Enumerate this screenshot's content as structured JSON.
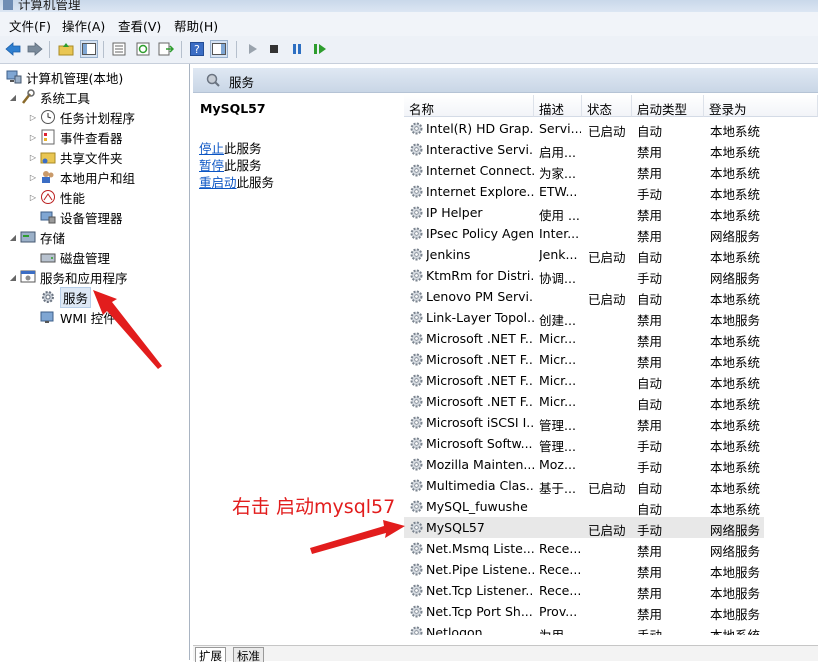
{
  "window": {
    "title": "计算机管理"
  },
  "menu": [
    {
      "label": "文件(F)"
    },
    {
      "label": "操作(A)"
    },
    {
      "label": "查看(V)"
    },
    {
      "label": "帮助(H)"
    }
  ],
  "tree": {
    "root": "计算机管理(本地)",
    "items": [
      {
        "label": "系统工具",
        "level": 1,
        "expanded": true,
        "icon": "tools-icon"
      },
      {
        "label": "任务计划程序",
        "level": 2,
        "expanded": false,
        "icon": "clock-icon"
      },
      {
        "label": "事件查看器",
        "level": 2,
        "expanded": false,
        "icon": "event-viewer-icon"
      },
      {
        "label": "共享文件夹",
        "level": 2,
        "expanded": false,
        "icon": "shared-folder-icon"
      },
      {
        "label": "本地用户和组",
        "level": 2,
        "expanded": false,
        "icon": "users-icon"
      },
      {
        "label": "性能",
        "level": 2,
        "expanded": false,
        "icon": "performance-icon"
      },
      {
        "label": "设备管理器",
        "level": 2,
        "expanded": null,
        "icon": "device-manager-icon"
      },
      {
        "label": "存储",
        "level": 1,
        "expanded": true,
        "icon": "storage-icon"
      },
      {
        "label": "磁盘管理",
        "level": 2,
        "expanded": null,
        "icon": "disk-icon"
      },
      {
        "label": "服务和应用程序",
        "level": 1,
        "expanded": true,
        "icon": "services-apps-icon"
      },
      {
        "label": "服务",
        "level": 2,
        "expanded": null,
        "icon": "gear-icon",
        "selected": true
      },
      {
        "label": "WMI 控件",
        "level": 2,
        "expanded": null,
        "icon": "wmi-icon"
      }
    ]
  },
  "main": {
    "header": "服务",
    "selected_service": "MySQL57",
    "actions": [
      {
        "link": "停止",
        "rest": "此服务"
      },
      {
        "link": "暂停",
        "rest": "此服务"
      },
      {
        "link": "重启动",
        "rest": "此服务"
      }
    ],
    "columns": [
      "名称",
      "描述",
      "状态",
      "启动类型",
      "登录为"
    ],
    "rows": [
      [
        "Intel(R) HD Grap...",
        "Servi...",
        "已启动",
        "自动",
        "本地系统"
      ],
      [
        "Interactive Servi...",
        "启用...",
        "",
        "禁用",
        "本地系统"
      ],
      [
        "Internet Connect...",
        "为家...",
        "",
        "禁用",
        "本地系统"
      ],
      [
        "Internet Explore...",
        "ETW...",
        "",
        "手动",
        "本地系统"
      ],
      [
        "IP Helper",
        "使用 ...",
        "",
        "禁用",
        "本地系统"
      ],
      [
        "IPsec Policy Agent",
        "Inter...",
        "",
        "禁用",
        "网络服务"
      ],
      [
        "Jenkins",
        "Jenk...",
        "已启动",
        "自动",
        "本地系统"
      ],
      [
        "KtmRm for Distri...",
        "协调...",
        "",
        "手动",
        "网络服务"
      ],
      [
        "Lenovo PM Servi...",
        "",
        "已启动",
        "自动",
        "本地系统"
      ],
      [
        "Link-Layer Topol...",
        "创建...",
        "",
        "禁用",
        "本地服务"
      ],
      [
        "Microsoft .NET F...",
        "Micr...",
        "",
        "禁用",
        "本地系统"
      ],
      [
        "Microsoft .NET F...",
        "Micr...",
        "",
        "禁用",
        "本地系统"
      ],
      [
        "Microsoft .NET F...",
        "Micr...",
        "",
        "自动",
        "本地系统"
      ],
      [
        "Microsoft .NET F...",
        "Micr...",
        "",
        "自动",
        "本地系统"
      ],
      [
        "Microsoft iSCSI I...",
        "管理...",
        "",
        "禁用",
        "本地系统"
      ],
      [
        "Microsoft Softw...",
        "管理...",
        "",
        "手动",
        "本地系统"
      ],
      [
        "Mozilla Mainten...",
        "Moz...",
        "",
        "手动",
        "本地系统"
      ],
      [
        "Multimedia Clas...",
        "基于...",
        "已启动",
        "自动",
        "本地系统"
      ],
      [
        "MySQL_fuwushe",
        "",
        "",
        "自动",
        "本地系统"
      ],
      [
        "MySQL57",
        "",
        "已启动",
        "手动",
        "网络服务"
      ],
      [
        "Net.Msmq Liste...",
        "Rece...",
        "",
        "禁用",
        "网络服务"
      ],
      [
        "Net.Pipe Listene...",
        "Rece...",
        "",
        "禁用",
        "本地服务"
      ],
      [
        "Net.Tcp Listener...",
        "Rece...",
        "",
        "禁用",
        "本地服务"
      ],
      [
        "Net.Tcp Port Sh...",
        "Prov...",
        "",
        "禁用",
        "本地服务"
      ],
      [
        "Netlogon",
        "为用...",
        "",
        "手动",
        "本地系统"
      ]
    ],
    "selected_row": 19
  },
  "tabs": [
    "扩展",
    "标准"
  ],
  "annotation": {
    "text": "右击 启动mysql57",
    "color": "#e21d1d"
  }
}
